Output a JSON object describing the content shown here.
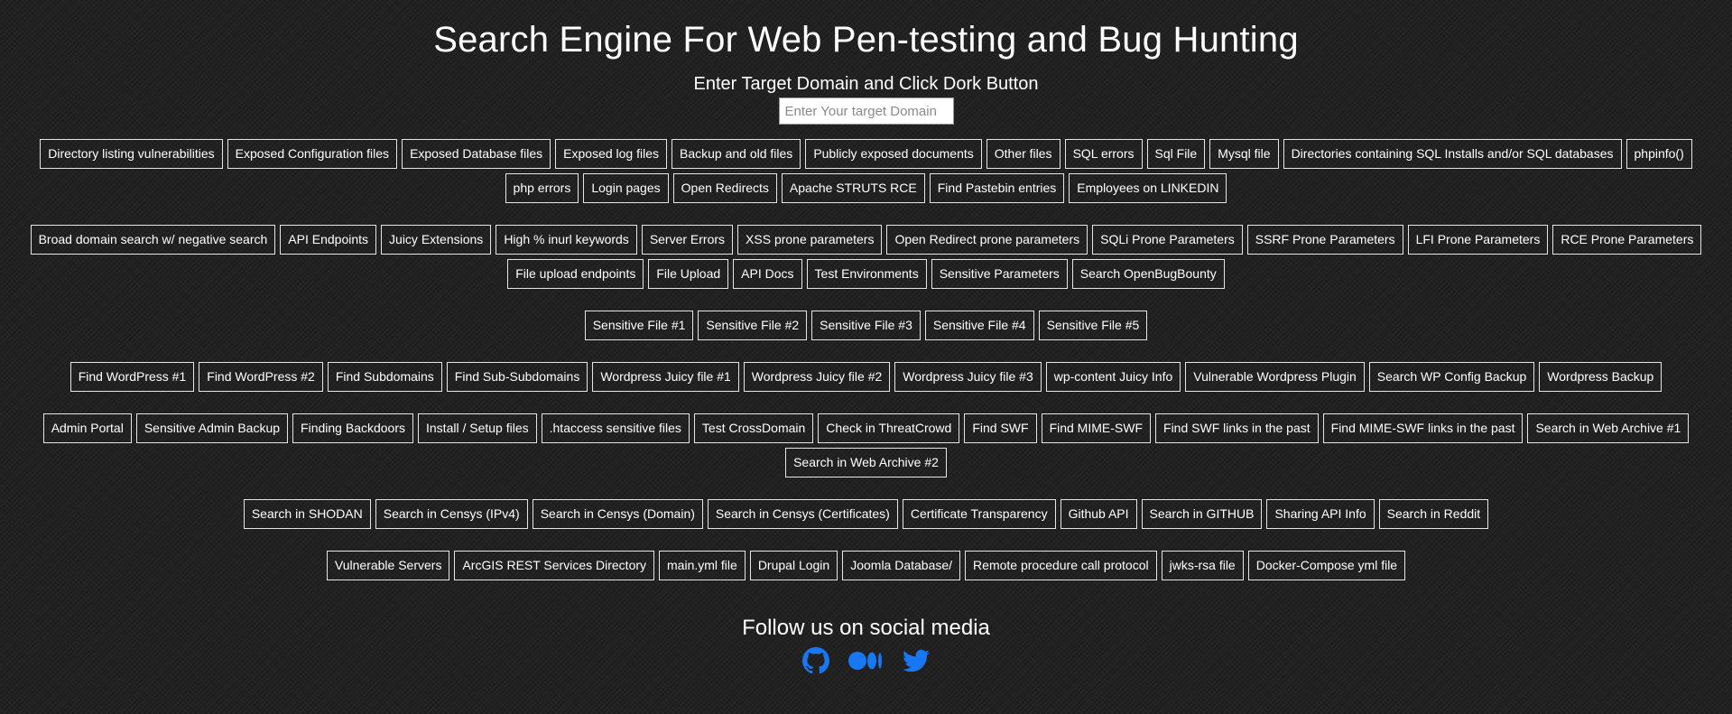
{
  "header": {
    "title": "Search Engine For Web Pen-testing and Bug Hunting",
    "subtitle": "Enter Target Domain and Click Dork Button"
  },
  "search": {
    "placeholder": "Enter Your target Domain",
    "value": ""
  },
  "groups": [
    {
      "buttons": [
        "Directory listing vulnerabilities",
        "Exposed Configuration files",
        "Exposed Database files",
        "Exposed log files",
        "Backup and old files",
        "Publicly exposed documents",
        "Other files",
        "SQL errors",
        "Sql File",
        "Mysql file",
        "Directories containing SQL Installs and/or SQL databases",
        "phpinfo()",
        "php errors",
        "Login pages",
        "Open Redirects",
        "Apache STRUTS RCE",
        "Find Pastebin entries",
        "Employees on LINKEDIN"
      ]
    },
    {
      "buttons": [
        "Broad domain search w/ negative search",
        "API Endpoints",
        "Juicy Extensions",
        "High % inurl keywords",
        "Server Errors",
        "XSS prone parameters",
        "Open Redirect prone parameters",
        "SQLi Prone Parameters",
        "SSRF Prone Parameters",
        "LFI Prone Parameters",
        "RCE Prone Parameters",
        "File upload endpoints",
        "File Upload",
        "API Docs",
        "Test Environments",
        "Sensitive Parameters",
        "Search OpenBugBounty"
      ]
    },
    {
      "buttons": [
        "Sensitive File #1",
        "Sensitive File #2",
        "Sensitive File #3",
        "Sensitive File #4",
        "Sensitive File #5"
      ]
    },
    {
      "buttons": [
        "Find WordPress #1",
        "Find WordPress #2",
        "Find Subdomains",
        "Find Sub-Subdomains",
        "Wordpress Juicy file #1",
        "Wordpress Juicy file #2",
        "Wordpress Juicy file #3",
        "wp-content Juicy Info",
        "Vulnerable Wordpress Plugin",
        "Search WP Config Backup",
        "Wordpress Backup"
      ]
    },
    {
      "buttons": [
        "Admin Portal",
        "Sensitive Admin Backup",
        "Finding Backdoors",
        "Install / Setup files",
        ".htaccess sensitive files",
        "Test CrossDomain",
        "Check in ThreatCrowd",
        "Find SWF",
        "Find MIME-SWF",
        "Find SWF links in the past",
        "Find MIME-SWF links in the past",
        "Search in Web Archive #1",
        "Search in Web Archive #2"
      ]
    },
    {
      "buttons": [
        "Search in SHODAN",
        "Search in Censys (IPv4)",
        "Search in Censys (Domain)",
        "Search in Censys (Certificates)",
        "Certificate Transparency",
        "Github API",
        "Search in GITHUB",
        "Sharing API Info",
        "Search in Reddit"
      ]
    },
    {
      "buttons": [
        "Vulnerable Servers",
        "ArcGIS REST Services Directory",
        "main.yml file",
        "Drupal Login",
        "Joomla Database/",
        "Remote procedure call protocol",
        "jwks-rsa file",
        "Docker-Compose yml file"
      ]
    }
  ],
  "footer": {
    "follow_text": "Follow us on social media",
    "social": [
      {
        "icon": "github-icon",
        "color": "#1877f2"
      },
      {
        "icon": "medium-icon",
        "color": "#1877f2"
      },
      {
        "icon": "twitter-icon",
        "color": "#1877f2"
      }
    ]
  },
  "colors": {
    "background": "#222222",
    "text": "#ffffff",
    "button_border": "#e6e6e6",
    "social_icon": "#1877f2"
  }
}
